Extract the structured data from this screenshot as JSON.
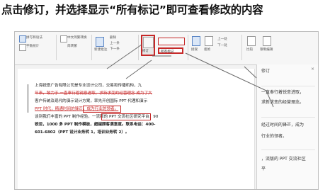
{
  "headline": "点击修订，并选择显示“所有标记”即可查看修改的内容",
  "ribbon": {
    "group1": [
      "拼写和语法",
      "字数统计"
    ],
    "group2": [
      "中文简繁转换",
      "简转繁"
    ],
    "group3": [
      "新建批注",
      "删除",
      "上一条",
      "下一条"
    ],
    "track_changes_label": "修订",
    "markup_dropdown_value": "所有标记",
    "group4": [
      "接受",
      "拒绝",
      "上一处",
      "下一处"
    ],
    "group5": [
      "比较",
      "限制编辑"
    ]
  },
  "document": {
    "lines": [
      "上海锐意广告有限公司是专业设计公司，交易和传播机构，九",
      "年来，致力于 一直奉行着锐意进取、求新求变的经营理念 成为了大",
      "客户传统及现代的演示设计方案，率先开创国际 PPT 代理和演示",
      "PPT 时代，精通时间的锋芒，成为行业的领者。",
      "谈到我们丰富的 PPT 制作经验，一流版的 PPT 交流社区研究平台，90",
      "锐设，1000 多 PPT 制作模板，超越顾客满意度。联系电话：400-",
      "601-6802（PPT 设计业务转 1，培训业务转 2）。"
    ]
  },
  "revisions_pane": {
    "title": "修订",
    "close": "×",
    "items": [
      "一直奉行着锐意进取，",
      "求新求变的经营理念。",
      "经过时间的锋芒，成为",
      "行业的领者。",
      "，流版的 PPT 交流社区",
      "平"
    ]
  }
}
